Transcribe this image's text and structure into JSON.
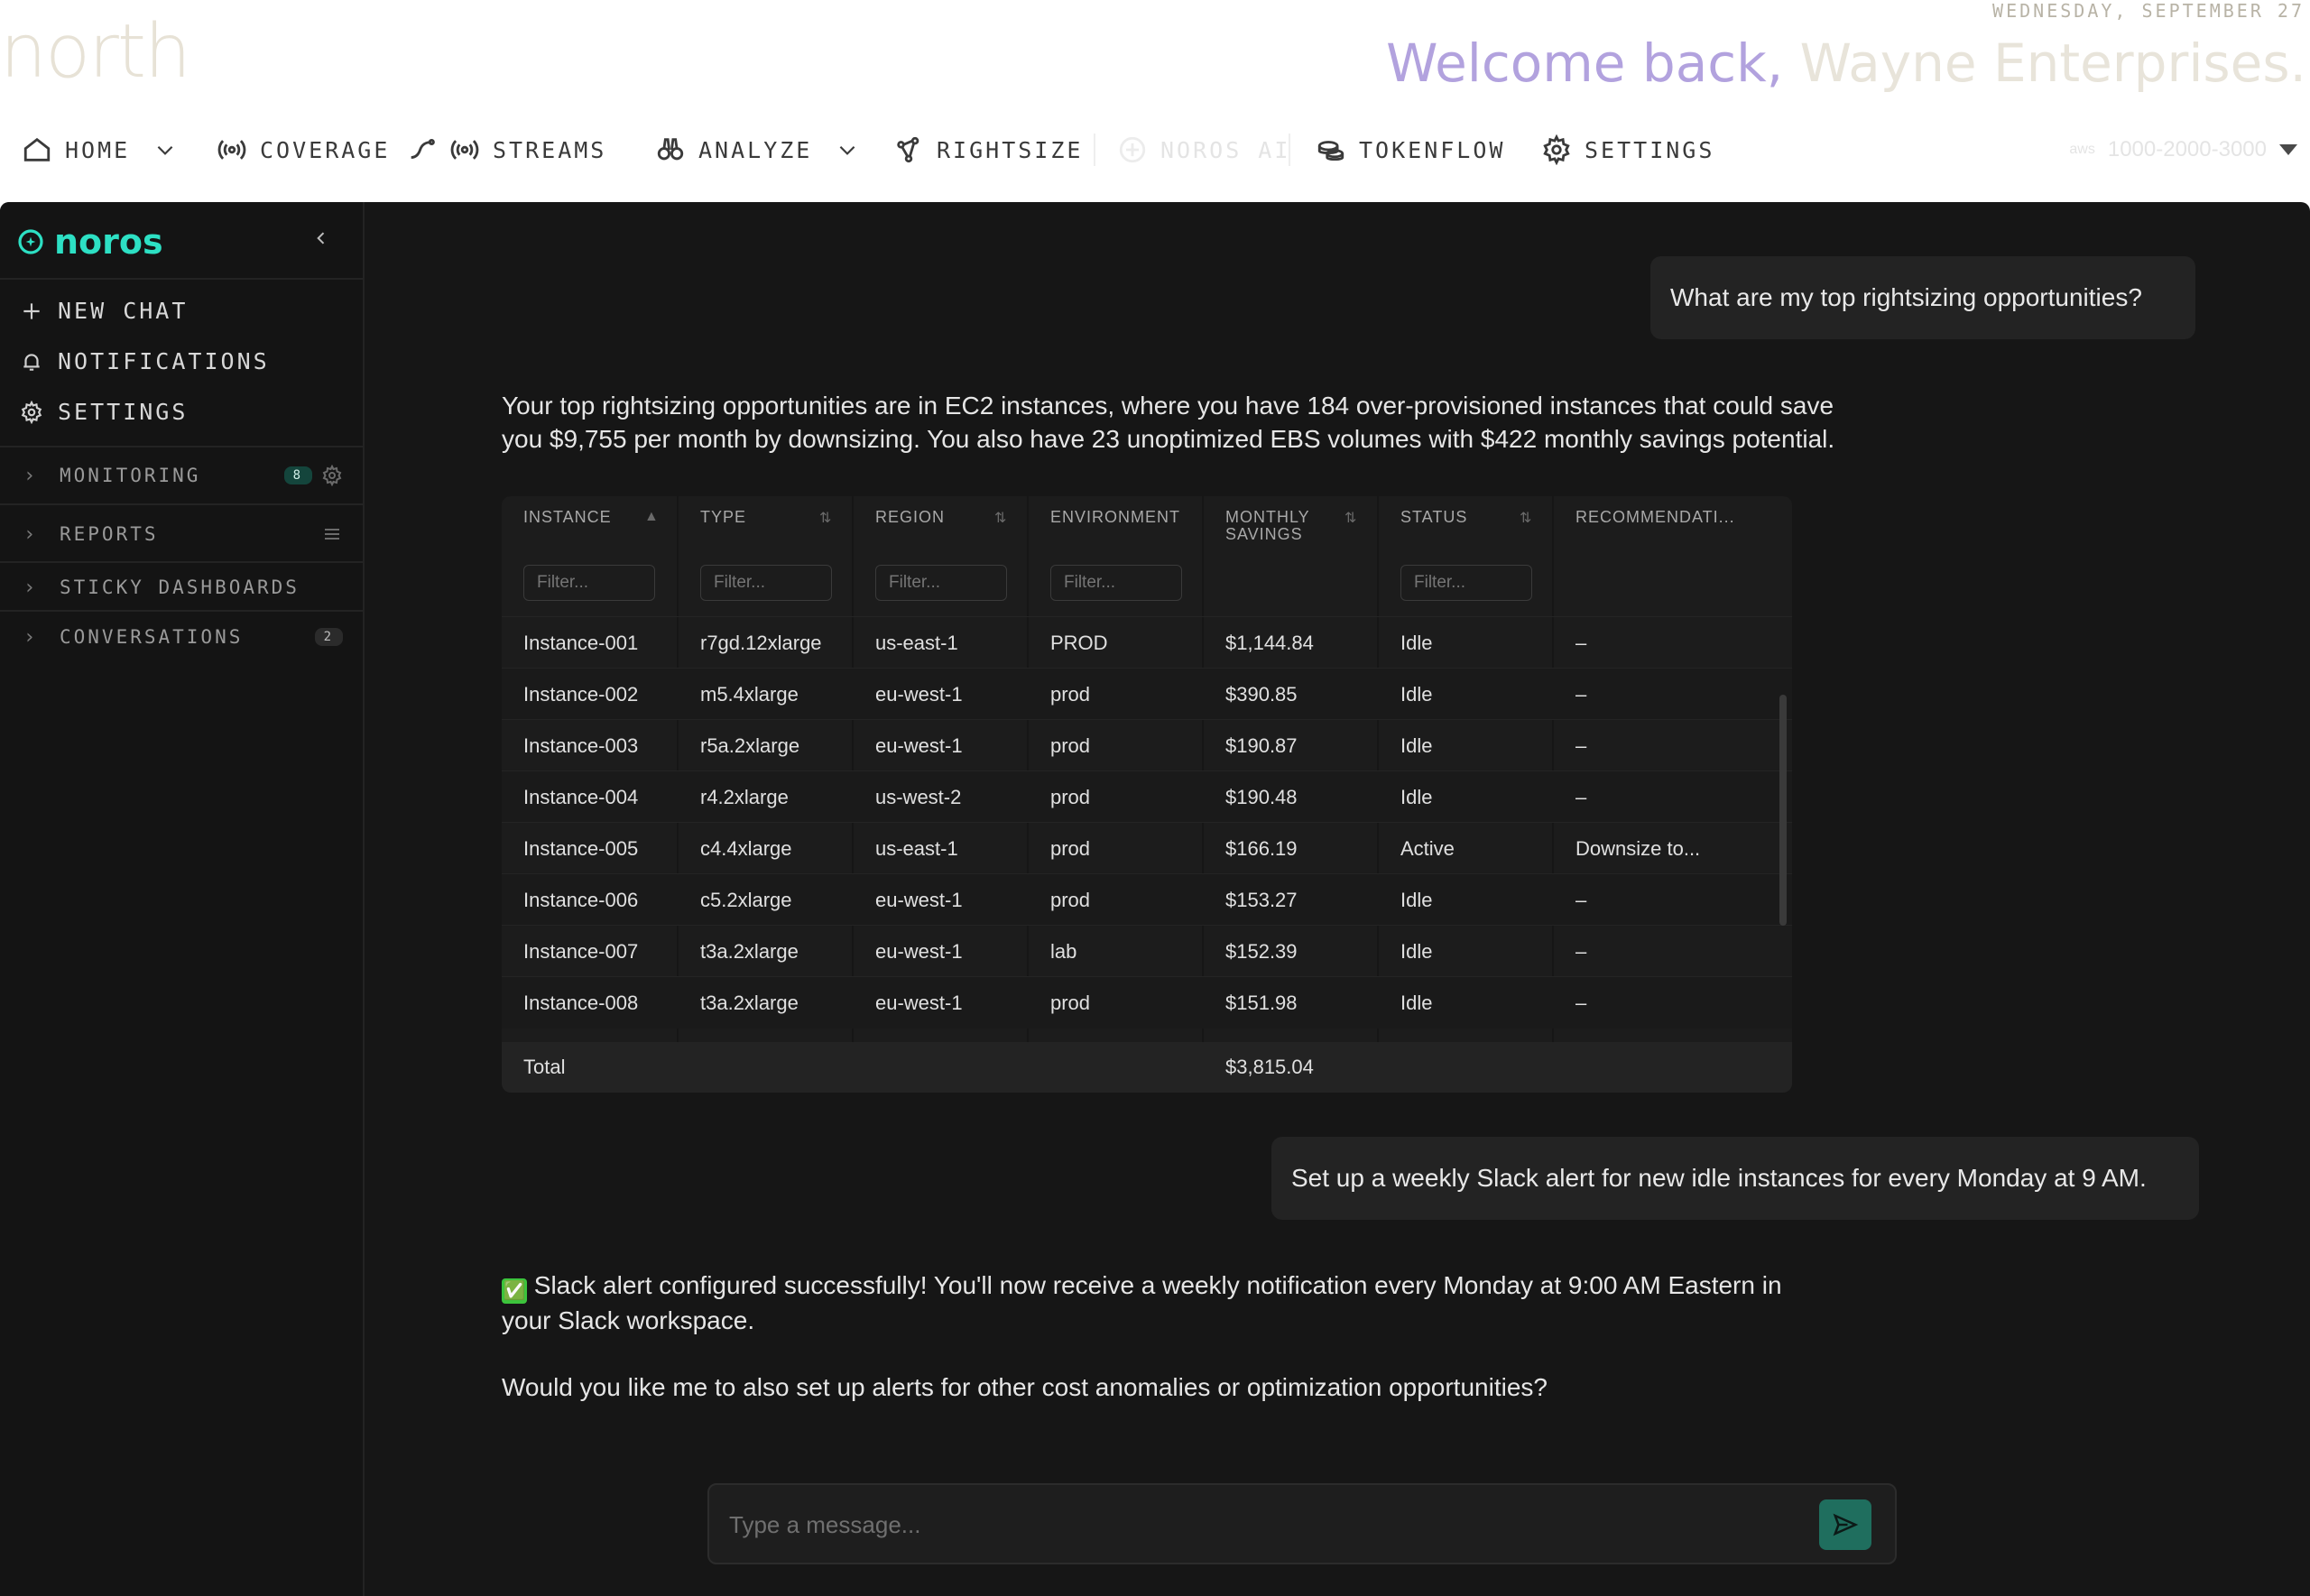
{
  "header": {
    "logo": "north",
    "date": "WEDNESDAY, SEPTEMBER 27",
    "welcome_prefix": "Welcome back,",
    "welcome_org": "Wayne Enterprises."
  },
  "nav": {
    "items": [
      {
        "label": "HOME",
        "icon": "home-icon"
      },
      {
        "label": "COVERAGE",
        "icon": "broadcast-icon"
      },
      {
        "label": "STREAMS",
        "icon": "broadcast-icon"
      },
      {
        "label": "ANALYZE",
        "icon": "binoculars-icon"
      },
      {
        "label": "RIGHTSIZE",
        "icon": "nodes-icon"
      },
      {
        "label": "NOROS AI",
        "icon": "noros-icon"
      },
      {
        "label": "TOKENFLOW",
        "icon": "coins-icon"
      },
      {
        "label": "SETTINGS",
        "icon": "gear-icon"
      }
    ],
    "account": "1000-2000-3000"
  },
  "sidebar": {
    "brand": "noros",
    "menu": {
      "new_chat": "NEW CHAT",
      "notifications": "NOTIFICATIONS",
      "settings": "SETTINGS"
    },
    "sections": [
      {
        "label": "MONITORING",
        "badge": "8"
      },
      {
        "label": "REPORTS"
      },
      {
        "label": "STICKY DASHBOARDS"
      },
      {
        "label": "CONVERSATIONS",
        "badge": "2"
      }
    ]
  },
  "chat": {
    "user_msg_1": "What are my top rightsizing opportunities?",
    "response_1_line1": "Your top rightsizing opportunities are in EC2 instances, where you have 184 over-provisioned instances that could save",
    "response_1_line2": "you $9,755 per month by downsizing. You also have 23 unoptimized EBS volumes with $422 monthly savings potential.",
    "user_msg_2": "Set up a weekly Slack alert for new idle instances for every Monday at 9 AM.",
    "response_2_emoji": "✅",
    "response_2_line1": "Slack alert configured successfully! You'll now receive a weekly notification every Monday at 9:00 AM Eastern in",
    "response_2_line2": "your Slack workspace.",
    "response_2_followup": "Would you like me to also set up alerts for other cost anomalies or optimization opportunities?",
    "composer_placeholder": "Type a message..."
  },
  "table": {
    "columns": [
      "INSTANCE",
      "TYPE",
      "REGION",
      "ENVIRONMENT",
      "MONTHLY SAVINGS",
      "STATUS",
      "RECOMMENDATI..."
    ],
    "col_monthly_line1": "MONTHLY",
    "col_monthly_line2": "SAVINGS",
    "filter_placeholder": "Filter...",
    "rows": [
      [
        "Instance-001",
        "r7gd.12xlarge",
        "us-east-1",
        "PROD",
        "$1,144.84",
        "Idle",
        "–"
      ],
      [
        "Instance-002",
        "m5.4xlarge",
        "eu-west-1",
        "prod",
        "$390.85",
        "Idle",
        "–"
      ],
      [
        "Instance-003",
        "r5a.2xlarge",
        "eu-west-1",
        "prod",
        "$190.87",
        "Idle",
        "–"
      ],
      [
        "Instance-004",
        "r4.2xlarge",
        "us-west-2",
        "prod",
        "$190.48",
        "Idle",
        "–"
      ],
      [
        "Instance-005",
        "c4.4xlarge",
        "us-east-1",
        "prod",
        "$166.19",
        "Active",
        "Downsize to..."
      ],
      [
        "Instance-006",
        "c5.2xlarge",
        "eu-west-1",
        "prod",
        "$153.27",
        "Idle",
        "–"
      ],
      [
        "Instance-007",
        "t3a.2xlarge",
        "eu-west-1",
        "lab",
        "$152.39",
        "Idle",
        "–"
      ],
      [
        "Instance-008",
        "t3a.2xlarge",
        "eu-west-1",
        "prod",
        "$151.98",
        "Idle",
        "–"
      ]
    ],
    "total_label": "Total",
    "total_value": "$3,815.04"
  },
  "colors": {
    "accent": "#2de0c4",
    "welcome": "#b2a2de",
    "panel": "#161616",
    "send": "#1f6e5e"
  }
}
